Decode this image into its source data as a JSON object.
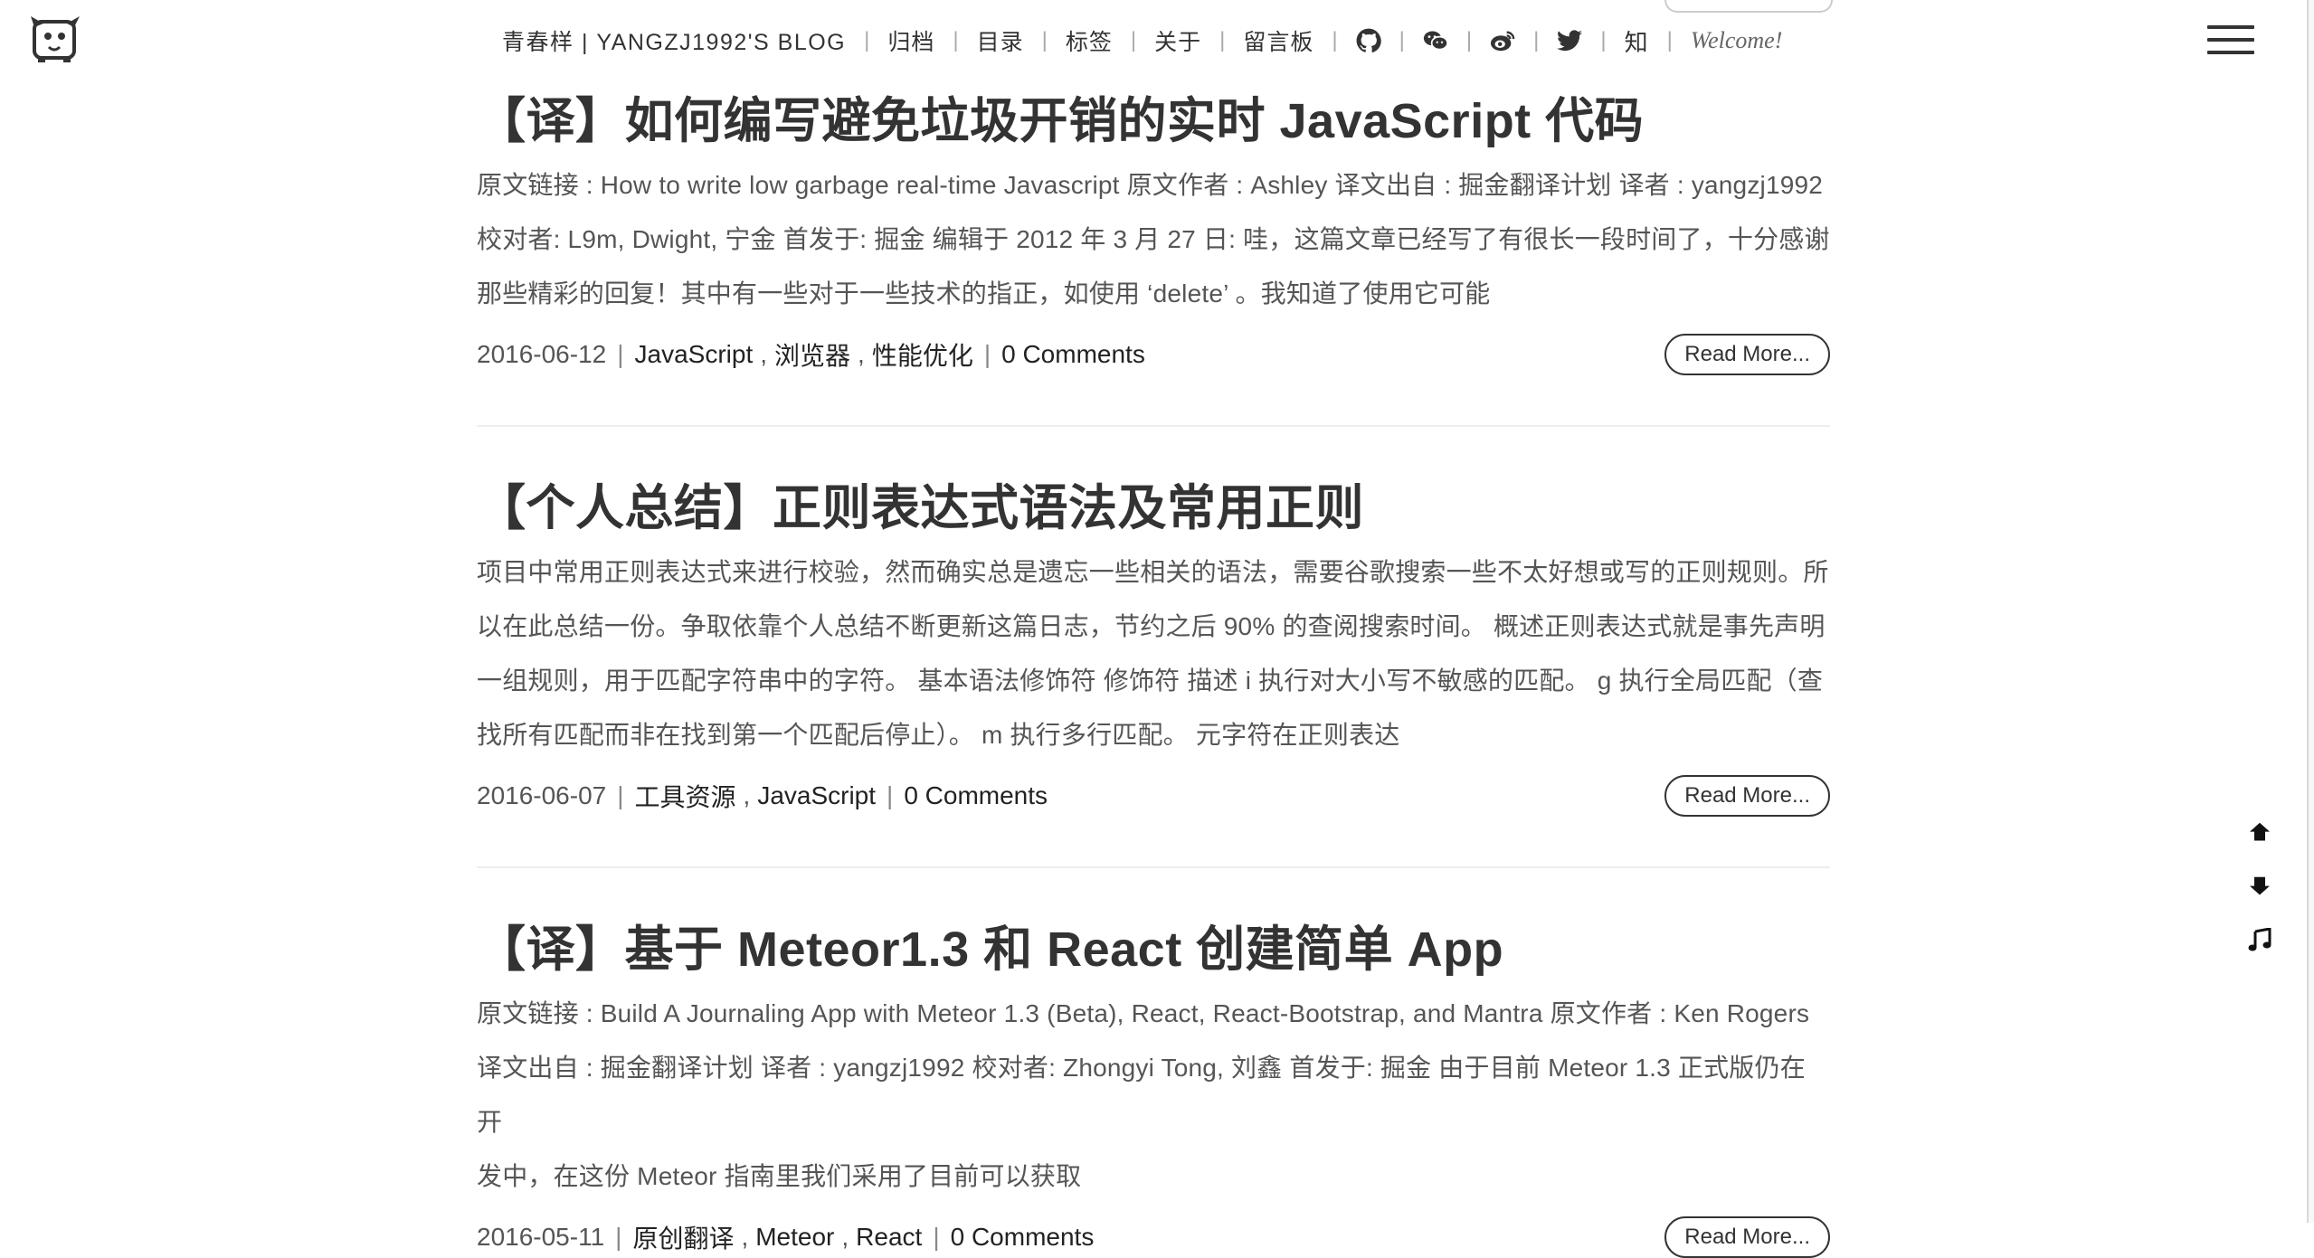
{
  "header": {
    "brand": "青春样 | YANGZJ1992'S BLOG",
    "nav": [
      "归档",
      "目录",
      "标签",
      "关于",
      "留言板"
    ],
    "social_icons": [
      "github-icon",
      "wechat-icon",
      "weibo-icon",
      "twitter-icon"
    ],
    "zhihu": "知",
    "welcome": "Welcome!"
  },
  "posts": [
    {
      "title": "【译】如何编写避免垃圾开销的实时 JavaScript 代码",
      "excerpt_lines": [
        "原文链接 : How to write low garbage real-time Javascript 原文作者 : Ashley 译文出自 : 掘金翻译计划 译者 : yangzj1992",
        "校对者: L9m, Dwight, 宁金 首发于: 掘金 编辑于 2012 年 3 月 27 日: 哇，这篇文章已经写了有很长一段时间了，十分感谢",
        "那些精彩的回复！其中有一些对于一些技术的指正，如使用 ‘delete’ 。我知道了使用它可能"
      ],
      "date": "2016-06-12",
      "tags": [
        "JavaScript",
        "浏览器",
        "性能优化"
      ],
      "comments": "0 Comments",
      "read_more": "Read More..."
    },
    {
      "title": "【个人总结】正则表达式语法及常用正则",
      "excerpt_lines": [
        "项目中常用正则表达式来进行校验，然而确实总是遗忘一些相关的语法，需要谷歌搜索一些不太好想或写的正则规则。所",
        "以在此总结一份。争取依靠个人总结不断更新这篇日志，节约之后 90% 的查阅搜索时间。 概述正则表达式就是事先声明",
        "一组规则，用于匹配字符串中的字符。 基本语法修饰符 修饰符 描述 i 执行对大小写不敏感的匹配。 g 执行全局匹配（查",
        "找所有匹配而非在找到第一个匹配后停止）。 m 执行多行匹配。 元字符在正则表达"
      ],
      "date": "2016-06-07",
      "tags": [
        "工具资源",
        "JavaScript"
      ],
      "comments": "0 Comments",
      "read_more": "Read More..."
    },
    {
      "title": "【译】基于 Meteor1.3 和 React 创建简单 App",
      "excerpt_lines": [
        "原文链接 : Build A Journaling App with Meteor 1.3 (Beta), React, React-Bootstrap, and Mantra 原文作者 : Ken Rogers",
        "译文出自 : 掘金翻译计划 译者 : yangzj1992 校对者: Zhongyi Tong, 刘鑫 首发于: 掘金 由于目前 Meteor 1.3 正式版仍在开",
        "发中，在这份 Meteor 指南里我们采用了目前可以获取"
      ],
      "date": "2016-05-11",
      "tags": [
        "原创翻译",
        "Meteor",
        "React"
      ],
      "comments": "0 Comments",
      "read_more": "Read More..."
    }
  ],
  "side_tools": [
    "arrow-up-icon",
    "arrow-down-icon",
    "music-note-icon"
  ]
}
